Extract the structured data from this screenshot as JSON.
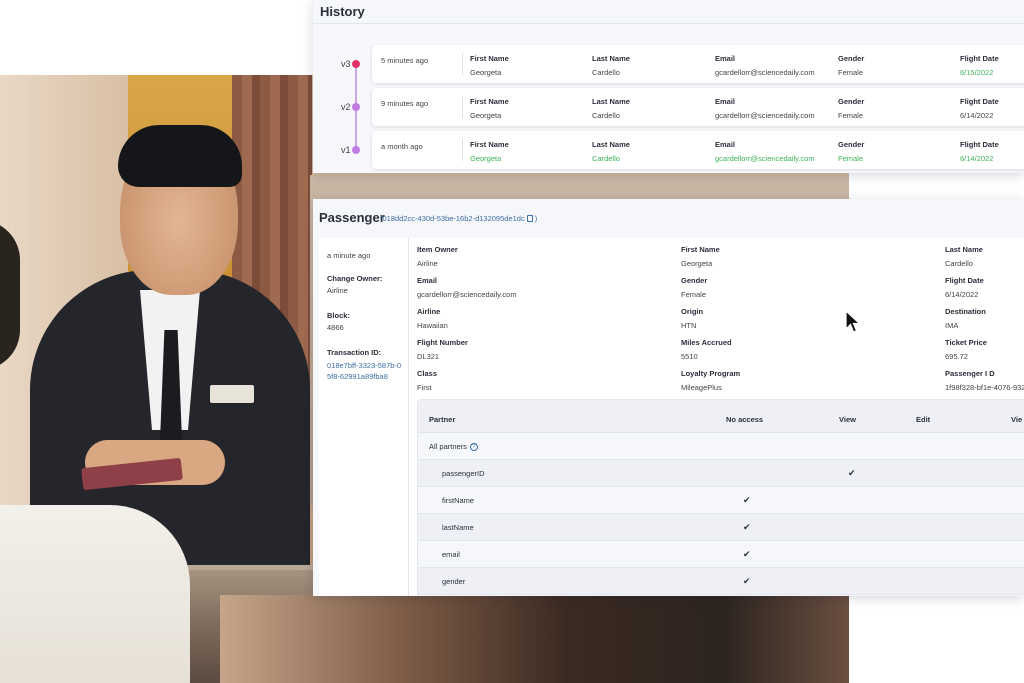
{
  "history": {
    "title": "History",
    "versions": [
      {
        "label": "v3",
        "color": "#e0336c",
        "ago": "5 minutes ago",
        "fields": [
          {
            "key": "First Name",
            "value": "Georgeta",
            "changed": false
          },
          {
            "key": "Last Name",
            "value": "Cardello",
            "changed": false
          },
          {
            "key": "Email",
            "value": "gcardellorr@sciencedaily.com",
            "changed": false
          },
          {
            "key": "Gender",
            "value": "Female",
            "changed": false
          },
          {
            "key": "Flight Date",
            "value": "6/15/2022",
            "changed": true
          }
        ]
      },
      {
        "label": "v2",
        "color": "#c07ce0",
        "ago": "9 minutes ago",
        "fields": [
          {
            "key": "First Name",
            "value": "Georgeta",
            "changed": false
          },
          {
            "key": "Last Name",
            "value": "Cardello",
            "changed": false
          },
          {
            "key": "Email",
            "value": "gcardellorr@sciencedaily.com",
            "changed": false
          },
          {
            "key": "Gender",
            "value": "Female",
            "changed": false
          },
          {
            "key": "Flight Date",
            "value": "6/14/2022",
            "changed": false
          }
        ]
      },
      {
        "label": "v1",
        "color": "#c07ce0",
        "ago": "a month ago",
        "fields": [
          {
            "key": "First Name",
            "value": "Georgeta",
            "changed": true
          },
          {
            "key": "Last Name",
            "value": "Cardello",
            "changed": true
          },
          {
            "key": "Email",
            "value": "gcardellorr@sciencedaily.com",
            "changed": true
          },
          {
            "key": "Gender",
            "value": "Female",
            "changed": true
          },
          {
            "key": "Flight Date",
            "value": "6/14/2022",
            "changed": true
          }
        ]
      }
    ]
  },
  "passenger": {
    "title": "Passenger",
    "id_prefix": "(018dd2cc-430d-53be-16b2-d132095de1dc",
    "id_suffix": ")",
    "sidebar": {
      "ago": "a minute ago",
      "change_owner_label": "Change Owner:",
      "change_owner_value": "Airline",
      "block_label": "Block:",
      "block_value": "4866",
      "tx_label": "Transaction ID:",
      "tx_value": "018e7bff-3323-587b-05f8-62991a89fba8"
    },
    "fields": [
      {
        "key": "Item Owner",
        "value": "Airline"
      },
      {
        "key": "First Name",
        "value": "Georgeta"
      },
      {
        "key": "Last Name",
        "value": "Cardello"
      },
      {
        "key": "Email",
        "value": "gcardellorr@sciencedaily.com"
      },
      {
        "key": "Gender",
        "value": "Female"
      },
      {
        "key": "Flight Date",
        "value": "6/14/2022"
      },
      {
        "key": "Airline",
        "value": "Hawaiian"
      },
      {
        "key": "Origin",
        "value": "HTN"
      },
      {
        "key": "Destination",
        "value": "IMA"
      },
      {
        "key": "Flight Number",
        "value": "DL321"
      },
      {
        "key": "Miles Accrued",
        "value": "5510"
      },
      {
        "key": "Ticket Price",
        "value": "695.72"
      },
      {
        "key": "Class",
        "value": "First"
      },
      {
        "key": "Loyalty Program",
        "value": "MileagePlus"
      },
      {
        "key": "Passenger I D",
        "value": "1f98f328-bf1e-4076-932"
      }
    ],
    "permissions": {
      "headers": [
        "Partner",
        "No access",
        "View",
        "Edit",
        "Vie"
      ],
      "all_partners": "All partners",
      "info_glyph": "?",
      "check_glyph": "✔",
      "rows": [
        {
          "name": "passengerID",
          "level": "View"
        },
        {
          "name": "firstName",
          "level": "No access"
        },
        {
          "name": "lastName",
          "level": "No access"
        },
        {
          "name": "email",
          "level": "No access"
        },
        {
          "name": "gender",
          "level": "No access"
        }
      ]
    }
  },
  "icons": {
    "copy": "copy-icon",
    "info": "info-icon",
    "cursor": "mouse-pointer-icon"
  },
  "colors": {
    "changed_value": "#3db45b",
    "link": "#3e6da0",
    "v3_dot": "#e0336c",
    "version_dot": "#c07ce0"
  }
}
